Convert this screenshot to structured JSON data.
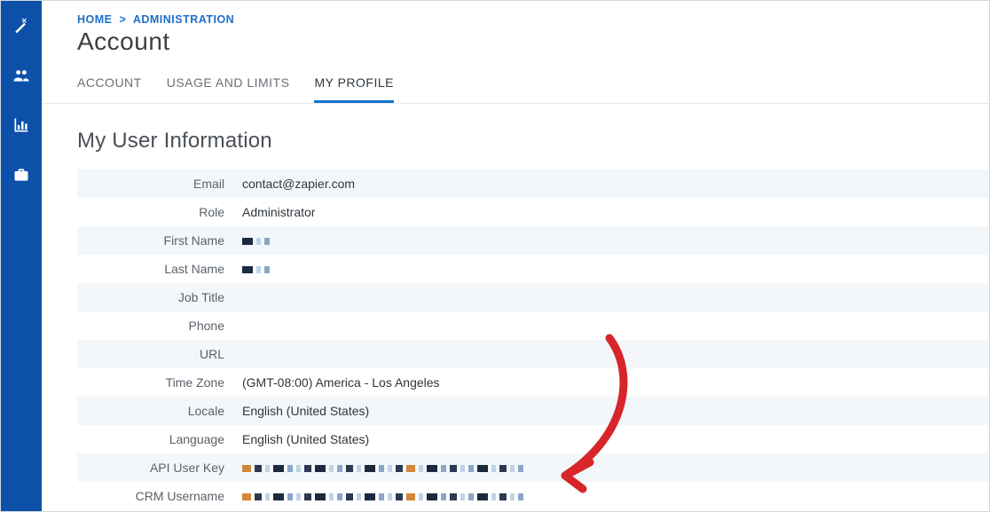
{
  "breadcrumb": {
    "home": "HOME",
    "section": "ADMINISTRATION"
  },
  "page_title": "Account",
  "tabs": [
    {
      "id": "account",
      "label": "ACCOUNT"
    },
    {
      "id": "usage",
      "label": "USAGE AND LIMITS"
    },
    {
      "id": "profile",
      "label": "MY PROFILE"
    }
  ],
  "active_tab": "profile",
  "section_title": "My User Information",
  "fields": [
    {
      "label": "Email",
      "value": "contact@zapier.com",
      "redacted": false
    },
    {
      "label": "Role",
      "value": "Administrator",
      "redacted": false
    },
    {
      "label": "First Name",
      "value": "",
      "redacted": true
    },
    {
      "label": "Last Name",
      "value": "",
      "redacted": true
    },
    {
      "label": "Job Title",
      "value": "",
      "redacted": false
    },
    {
      "label": "Phone",
      "value": "",
      "redacted": false
    },
    {
      "label": "URL",
      "value": "",
      "redacted": false
    },
    {
      "label": "Time Zone",
      "value": "(GMT-08:00) America - Los Angeles",
      "redacted": false
    },
    {
      "label": "Locale",
      "value": "English (United States)",
      "redacted": false
    },
    {
      "label": "Language",
      "value": "English (United States)",
      "redacted": false
    },
    {
      "label": "API User Key",
      "value": "",
      "redacted": true
    },
    {
      "label": "CRM Username",
      "value": "",
      "redacted": true
    }
  ],
  "sidebar": {
    "items": [
      {
        "id": "wand",
        "name": "magic-wand-icon"
      },
      {
        "id": "users",
        "name": "users-icon"
      },
      {
        "id": "reports",
        "name": "bar-chart-icon"
      },
      {
        "id": "briefcase",
        "name": "briefcase-icon"
      }
    ]
  },
  "colors": {
    "sidebar": "#0d50aa",
    "accent": "#1372cf",
    "link": "#1c6fc9"
  },
  "annotation": {
    "arrow_color": "#d7262b"
  }
}
